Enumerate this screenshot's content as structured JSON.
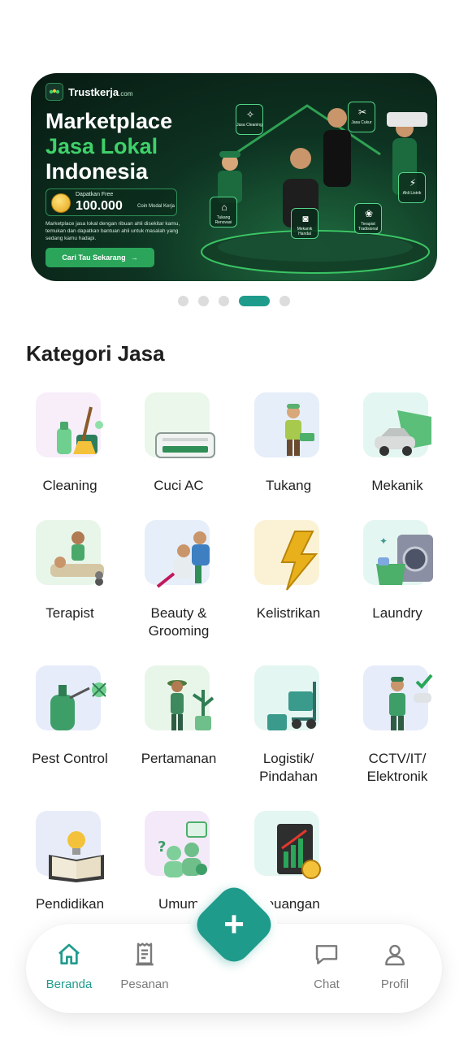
{
  "banner": {
    "brand": "Trustkerja",
    "brand_suffix": ".com",
    "headline_1": "Marketplace",
    "headline_2": "Jasa Lokal",
    "headline_3": "Indonesia",
    "coin_label": "Dapatkan Free",
    "coin_amount": "100.000",
    "coin_suffix": "Coin Modal Kerja",
    "description": "Marketplace jasa lokal dengan ribuan ahli disekitar kamu, temukan dan dapatkan bantuan ahli untuk masalah yang sedang kamu hadapi.",
    "cta_label": "Cari Tau Sekarang",
    "tags": [
      {
        "label": "Jasa Cleaning",
        "icon": "spray-icon"
      },
      {
        "label": "Jasa Cukur",
        "icon": "scissors-icon"
      },
      {
        "label": "Ahli Listrik",
        "icon": "bolt-icon"
      },
      {
        "label": "Tukang Renovasi",
        "icon": "house-icon"
      },
      {
        "label": "Mekanik Handal",
        "icon": "car-icon"
      },
      {
        "label": "Terapist Tradisional",
        "icon": "lotus-icon"
      }
    ]
  },
  "carousel": {
    "total": 5,
    "active_index": 3
  },
  "section_title": "Kategori Jasa",
  "categories": [
    {
      "label": "Cleaning",
      "icon": "cleaning-supplies-icon",
      "bg": "#f7eefa"
    },
    {
      "label": "Cuci AC",
      "icon": "air-conditioner-icon",
      "bg": "#eaf7ea"
    },
    {
      "label": "Tukang",
      "icon": "handyman-icon",
      "bg": "#e5eef9"
    },
    {
      "label": "Mekanik",
      "icon": "car-mechanic-icon",
      "bg": "#e4f6f1"
    },
    {
      "label": "Terapist",
      "icon": "massage-therapist-icon",
      "bg": "#e8f6ea"
    },
    {
      "label": "Beauty &\nGrooming",
      "icon": "barber-icon",
      "bg": "#e5eef9"
    },
    {
      "label": "Kelistrikan",
      "icon": "lightning-bolt-icon",
      "bg": "#fbf2d6"
    },
    {
      "label": "Laundry",
      "icon": "washing-machine-icon",
      "bg": "#e4f6f1"
    },
    {
      "label": "Pest Control",
      "icon": "pest-sprayer-icon",
      "bg": "#e6ecfa"
    },
    {
      "label": "Pertamanan",
      "icon": "gardener-icon",
      "bg": "#e8f6ea"
    },
    {
      "label": "Logistik/\nPindahan",
      "icon": "hand-truck-icon",
      "bg": "#e4f6f1"
    },
    {
      "label": "CCTV/IT/\nElektronik",
      "icon": "cctv-technician-icon",
      "bg": "#e6ecfa"
    },
    {
      "label": "Pendidikan",
      "icon": "book-lightbulb-icon",
      "bg": "#e8ecf8"
    },
    {
      "label": "Umum",
      "icon": "people-chat-icon",
      "bg": "#f4e9f8"
    },
    {
      "label": "Keuangan",
      "icon": "finance-chart-icon",
      "bg": "#e4f6f1"
    }
  ],
  "nav": {
    "items": [
      {
        "label": "Beranda",
        "icon": "home-icon",
        "active": true
      },
      {
        "label": "Pesanan",
        "icon": "receipt-icon",
        "active": false
      },
      {
        "label": "Chat",
        "icon": "chat-icon",
        "active": false
      },
      {
        "label": "Profil",
        "icon": "user-icon",
        "active": false
      }
    ],
    "fab_icon": "plus-icon",
    "fab_symbol": "+"
  },
  "colors": {
    "accent": "#1f9b8c",
    "banner_green": "#3fd16a"
  }
}
